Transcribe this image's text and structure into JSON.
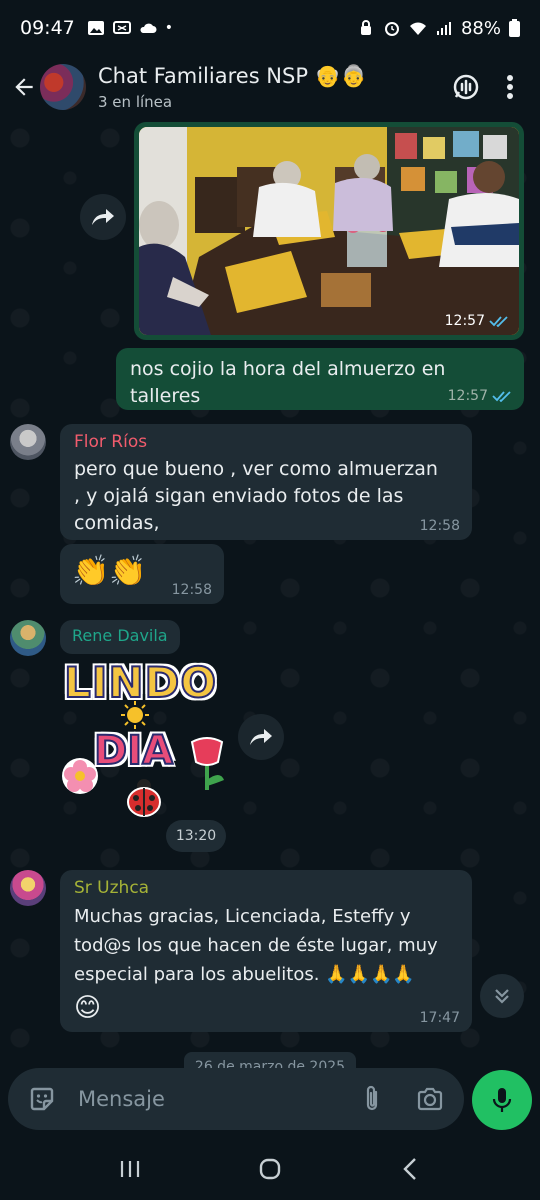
{
  "status": {
    "time": "09:47",
    "battery": "88%"
  },
  "header": {
    "title": "Chat Familiares NSP 👴👵",
    "subtitle": "3 en línea"
  },
  "messages": {
    "photo_time": "12:57",
    "out_text": "nos cojio la hora del almuerzo en talleres",
    "out_time": "12:57",
    "flor": {
      "name": "Flor Ríos",
      "text": "pero que bueno ,  ver  como almuerzan , y ojalá sigan enviado fotos  de las comidas,",
      "time": "12:58"
    },
    "clap": {
      "text": "👏👏",
      "time": "12:58"
    },
    "rene": {
      "name": "Rene Davila",
      "sticker_line1": "LINDO",
      "sticker_line2": "DIA",
      "time": "13:20"
    },
    "uzhca": {
      "name": "Sr Uzhca",
      "text": "Muchas gracias, Licenciada, Esteffy y tod@s los que hacen de éste lugar, muy especial para los abuelitos. 🙏🙏🙏🙏",
      "emoji": "😊",
      "time": "17:47"
    },
    "date_partial": "26 de marzo de 2025"
  },
  "composer": {
    "placeholder": "Mensaje"
  },
  "colors": {
    "background": "#0b141a",
    "outgoing": "#144d37",
    "incoming": "#1f2c34",
    "accent": "#21c063",
    "tick_blue": "#53bdeb",
    "flor_name": "#f15c6d",
    "rene_name": "#1fa68a",
    "uzhca_name": "#a5b337"
  }
}
